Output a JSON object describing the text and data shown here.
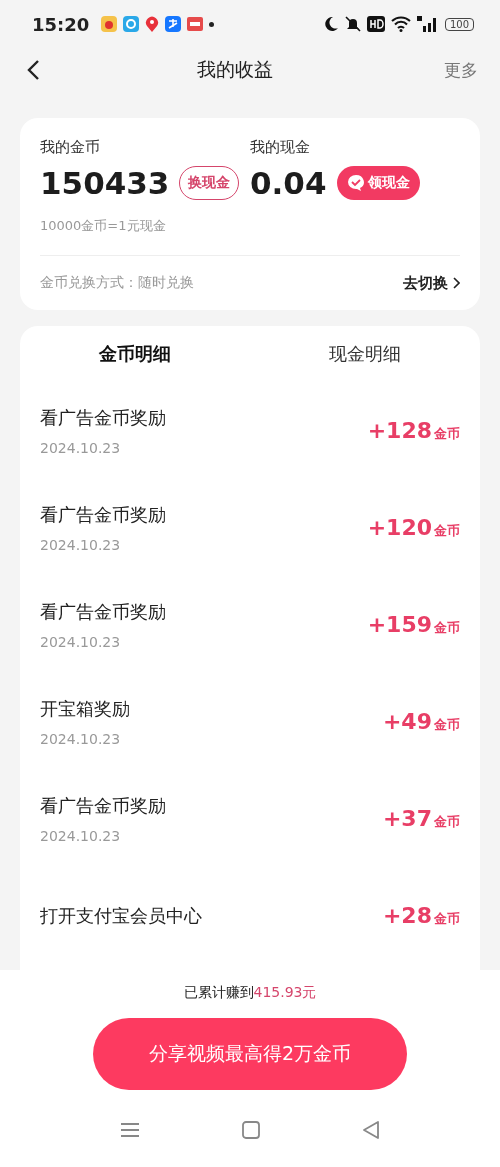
{
  "status_bar": {
    "time": "15:20",
    "battery": "100"
  },
  "header": {
    "title": "我的收益",
    "more": "更多"
  },
  "summary": {
    "coins_label": "我的金币",
    "coins": "150433",
    "exchange_button": "换现金",
    "cash_label": "我的现金",
    "cash": "0.04",
    "withdraw_button": "领现金",
    "rate": "10000金币=1元现金",
    "mode": "金币兑换方式：随时兑换",
    "switch_link": "去切换"
  },
  "tabs": [
    {
      "label": "金币明细",
      "selected": true
    },
    {
      "label": "现金明细",
      "selected": false
    }
  ],
  "records": [
    {
      "title": "看广告金币奖励",
      "date": "2024.10.23",
      "amount": "+128",
      "unit": "金币"
    },
    {
      "title": "看广告金币奖励",
      "date": "2024.10.23",
      "amount": "+120",
      "unit": "金币"
    },
    {
      "title": "看广告金币奖励",
      "date": "2024.10.23",
      "amount": "+159",
      "unit": "金币"
    },
    {
      "title": "开宝箱奖励",
      "date": "2024.10.23",
      "amount": "+49",
      "unit": "金币"
    },
    {
      "title": "看广告金币奖励",
      "date": "2024.10.23",
      "amount": "+37",
      "unit": "金币"
    },
    {
      "title": "打开支付宝会员中心",
      "amount": "+28",
      "unit": "金币"
    }
  ],
  "footer": {
    "earned_label": "已累计赚到",
    "earned_amount": "415.93元",
    "share_button": "分享视频最高得2万金币"
  }
}
